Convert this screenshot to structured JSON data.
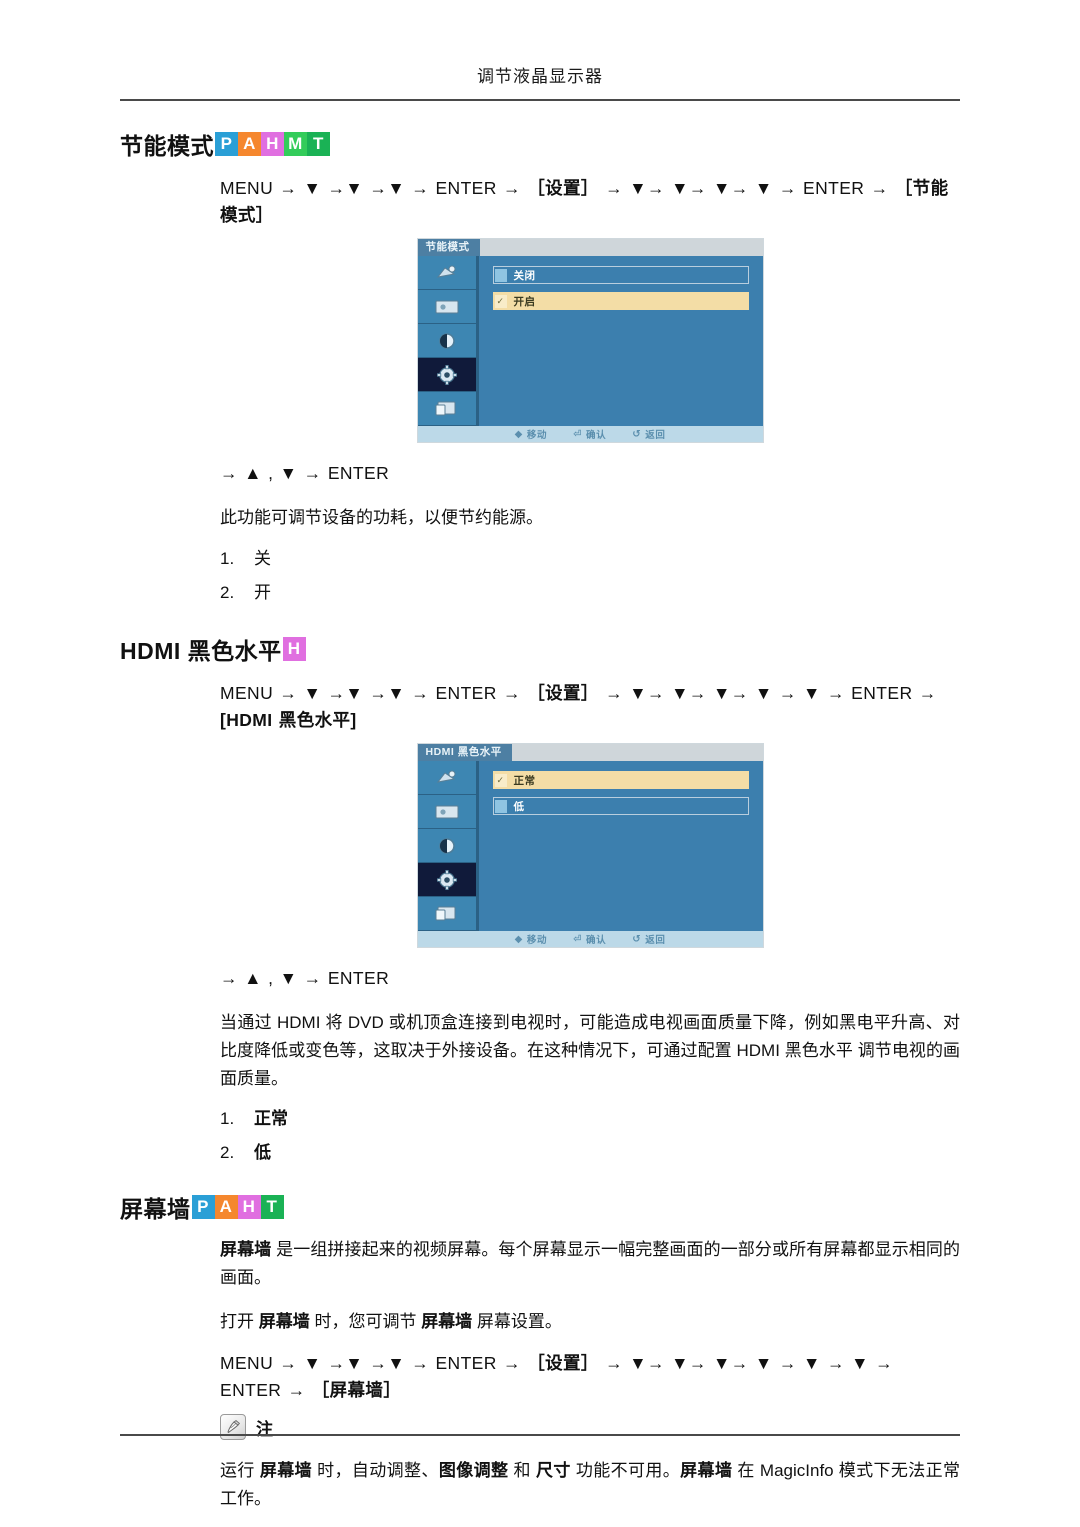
{
  "header": {
    "title": "调节液晶显示器"
  },
  "badge_colors": {
    "P": "#2a9fd6",
    "A": "#f5872e",
    "H": "#e06fe0",
    "M": "#33cc5a",
    "T": "#1ab255"
  },
  "sections": [
    {
      "id": "eco-mode",
      "heading": "节能模式",
      "badges": [
        "P",
        "A",
        "H",
        "M",
        "T"
      ],
      "path": "MENU → ▼ →▼ →▼ → ENTER → ［设置］ → ▼→ ▼→ ▼→ ▼ → ENTER → ［节能模式］",
      "path_parts": [
        {
          "t": "MENU → ▼ →▼ →▼ → ENTER → ",
          "cjk": false
        },
        {
          "t": "［设置］",
          "cjk": true
        },
        {
          "t": " → ▼→ ▼→ ▼→ ▼ → ENTER → ",
          "cjk": false
        },
        {
          "t": "［节能模式］",
          "cjk": true
        }
      ],
      "osd": {
        "title": "节能模式",
        "options": [
          {
            "label": "关闭",
            "selected": false
          },
          {
            "label": "开启",
            "selected": true
          }
        ],
        "footer": [
          {
            "glyph": "◆",
            "label": "移动"
          },
          {
            "glyph": "⏎",
            "label": "确认"
          },
          {
            "glyph": "↺",
            "label": "返回"
          }
        ]
      },
      "enter_line": "→ ▲ ,  ▼ → ENTER",
      "description": "此功能可调节设备的功耗，以便节约能源。",
      "options_list": [
        {
          "num": "1.",
          "value": "关"
        },
        {
          "num": "2.",
          "value": "开"
        }
      ],
      "options_bold": false
    },
    {
      "id": "hdmi-black-level",
      "heading": "HDMI 黑色水平",
      "badges": [
        "H"
      ],
      "path_parts": [
        {
          "t": "MENU → ▼ →▼ →▼ → ENTER → ",
          "cjk": false
        },
        {
          "t": "［设置］",
          "cjk": true
        },
        {
          "t": " → ▼→ ▼→ ▼→ ▼ → ▼ → ENTER → ",
          "cjk": false
        },
        {
          "t": "[HDMI 黑色水平]",
          "cjk": true
        }
      ],
      "osd": {
        "title": "HDMI 黑色水平",
        "options": [
          {
            "label": "正常",
            "selected": true
          },
          {
            "label": "低",
            "selected": false
          }
        ],
        "footer": [
          {
            "glyph": "◆",
            "label": "移动"
          },
          {
            "glyph": "⏎",
            "label": "确认"
          },
          {
            "glyph": "↺",
            "label": "返回"
          }
        ]
      },
      "enter_line": "→ ▲ ,  ▼ → ENTER",
      "description": "当通过 HDMI 将 DVD 或机顶盒连接到电视时，可能造成电视画面质量下降，例如黑电平升高、对比度降低或变色等，这取决于外接设备。在这种情况下，可通过配置  HDMI  黑色水平 调节电视的画面质量。",
      "options_list": [
        {
          "num": "1.",
          "value": "正常"
        },
        {
          "num": "2.",
          "value": "低"
        }
      ],
      "options_bold": true
    },
    {
      "id": "video-wall",
      "heading": "屏幕墙",
      "badges": [
        "P",
        "A",
        "H",
        "T"
      ],
      "para1_bold": "屏幕墙",
      "para1_rest": "  是一组拼接起来的视频屏幕。每个屏幕显示一幅完整画面的一部分或所有屏幕都显示相同的画面。",
      "para2_pre": "打开 ",
      "para2_b1": "屏幕墙",
      "para2_mid": " 时，您可调节 ",
      "para2_b2": "屏幕墙",
      "para2_post": " 屏幕设置。",
      "path_parts": [
        {
          "t": "MENU → ▼ →▼ →▼ → ENTER → ",
          "cjk": false
        },
        {
          "t": "［设置］",
          "cjk": true
        },
        {
          "t": " → ▼→ ▼→ ▼→ ▼ → ▼ → ▼ → ENTER → ",
          "cjk": false
        },
        {
          "t": "［屏幕墙］",
          "cjk": true
        }
      ],
      "note": {
        "icon": "note-pencil-icon",
        "label": "注",
        "text_parts": [
          {
            "t": "运行 ",
            "b": false
          },
          {
            "t": "屏幕墙",
            "b": true
          },
          {
            "t": " 时，自动调整、",
            "b": false
          },
          {
            "t": "图像调整",
            "b": true
          },
          {
            "t": " 和 ",
            "b": false
          },
          {
            "t": "尺寸",
            "b": true
          },
          {
            "t": " 功能不可用。",
            "b": false
          },
          {
            "t": "屏幕墙",
            "b": true
          },
          {
            "t": " 在 MagicInfo 模式下无法正常工作。",
            "b": false
          }
        ]
      }
    }
  ]
}
